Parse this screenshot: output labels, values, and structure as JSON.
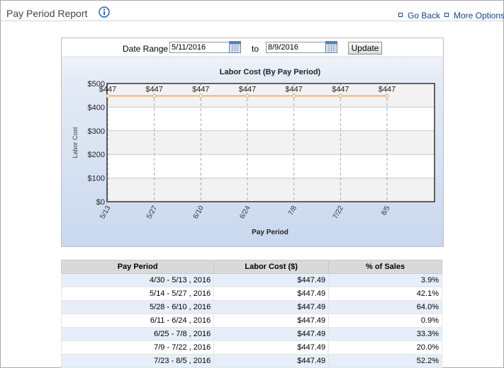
{
  "header": {
    "title": "Pay Period Report",
    "go_back": "Go Back",
    "more_options": "More Options"
  },
  "date_range": {
    "label": "Date Range :",
    "start": "5/11/2016",
    "to_label": "to",
    "end": "8/9/2016",
    "update_label": "Update"
  },
  "chart_data": {
    "type": "line",
    "title": "Labor Cost (By Pay Period)",
    "xlabel": "Pay Period",
    "ylabel": "Labor Cost",
    "categories": [
      "5/13",
      "5/27",
      "6/10",
      "6/24",
      "7/8",
      "7/22",
      "8/5"
    ],
    "series": [
      {
        "values": [
          447.49,
          447.49,
          447.49,
          447.49,
          447.49,
          447.49,
          447.49
        ]
      }
    ],
    "point_labels": [
      "$447",
      "$447",
      "$447",
      "$447",
      "$447",
      "$447",
      "$447"
    ],
    "ylim": [
      0,
      500
    ],
    "yticks": [
      0,
      100,
      200,
      300,
      400,
      500
    ],
    "ytick_labels": [
      "$0",
      "$100",
      "$200",
      "$300",
      "$400",
      "$500"
    ],
    "grid": true,
    "colors": {
      "line": "#f0a060",
      "band": "#f2f2f2"
    }
  },
  "table": {
    "columns": [
      "Pay Period",
      "Labor Cost ($)",
      "% of Sales"
    ],
    "rows": [
      [
        "4/30 - 5/13 , 2016",
        "$447.49",
        "3.9%"
      ],
      [
        "5/14 - 5/27 , 2016",
        "$447.49",
        "42.1%"
      ],
      [
        "5/28 - 6/10 , 2016",
        "$447.49",
        "64.0%"
      ],
      [
        "6/11 - 6/24 , 2016",
        "$447.49",
        "0.9%"
      ],
      [
        "6/25 - 7/8 , 2016",
        "$447.49",
        "33.3%"
      ],
      [
        "7/9 - 7/22 , 2016",
        "$447.49",
        "20.0%"
      ],
      [
        "7/23 - 8/5 , 2016",
        "$447.49",
        "52.2%"
      ]
    ]
  }
}
